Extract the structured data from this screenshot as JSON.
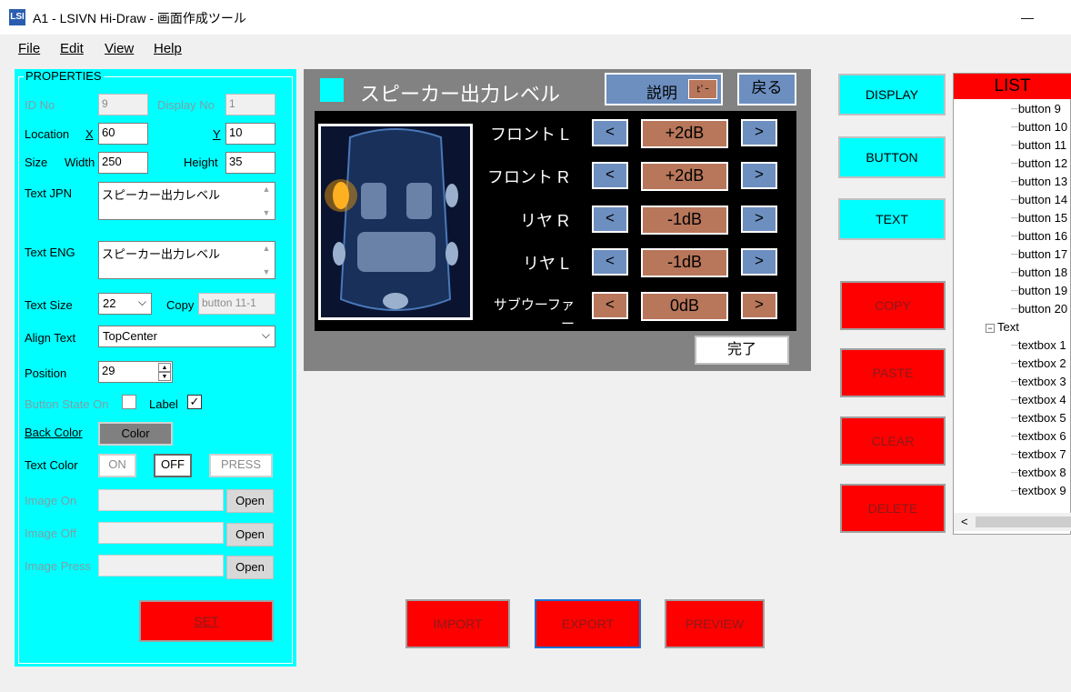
{
  "window": {
    "app_icon": "LSI",
    "title": "A1 - LSIVN Hi-Draw - 画面作成ツール",
    "minimize": "—"
  },
  "menu": [
    "File",
    "Edit",
    "View",
    "Help"
  ],
  "properties": {
    "title": "PROPERTIES",
    "id_no_label": "ID No",
    "id_no": "9",
    "display_no_label": "Display No",
    "display_no": "1",
    "location_label": "Location",
    "x_label": "X",
    "x": "60",
    "y_label": "Y",
    "y": "10",
    "size_label": "Size",
    "width_label": "Width",
    "width": "250",
    "height_label": "Height",
    "height": "35",
    "text_jpn_label": "Text JPN",
    "text_jpn": "スピーカー出力レベル",
    "text_eng_label": "Text ENG",
    "text_eng": "スピーカー出力レベル",
    "text_size_label": "Text Size",
    "text_size": "22",
    "copy_label": "Copy",
    "copy_value": "button 11-1",
    "align_label": "Align Text",
    "align": "TopCenter",
    "position_label": "Position",
    "position": "29",
    "button_state_label": "Button State On",
    "label_label": "Label",
    "label_checked": "✓",
    "back_color_label": "Back Color",
    "color_button": "Color",
    "text_color_label": "Text Color",
    "on": "ON",
    "off": "OFF",
    "press": "PRESS",
    "image_on_label": "Image On",
    "image_off_label": "Image Off",
    "image_press_label": "Image Press",
    "open": "Open",
    "set": "SET"
  },
  "preview": {
    "title": "スピーカー出力レベル",
    "explain": "説明",
    "explain_icon": "ﾋﾟｰ",
    "back": "戻る",
    "rows": [
      {
        "label": "フロント L",
        "value": "+2dB"
      },
      {
        "label": "フロント R",
        "value": "+2dB"
      },
      {
        "label": "リヤ R",
        "value": "-1dB"
      },
      {
        "label": "リヤ L",
        "value": "-1dB"
      },
      {
        "label": "サブウーファー",
        "value": "0dB"
      }
    ],
    "left_arrow": "<",
    "right_arrow": ">",
    "done": "完了"
  },
  "actions": {
    "import": "IMPORT",
    "export": "EXPORT",
    "preview": "PREVIEW"
  },
  "side_buttons": {
    "display": "DISPLAY",
    "button": "BUTTON",
    "text": "TEXT",
    "copy": "COPY",
    "paste": "PASTE",
    "clear": "CLEAR",
    "delete": "DELETE"
  },
  "list": {
    "header": "LIST",
    "buttons": [
      "button 9",
      "button 10",
      "button 11",
      "button 12",
      "button 13",
      "button 14",
      "button 15",
      "button 16",
      "button 17",
      "button 18",
      "button 19",
      "button 20"
    ],
    "text_node": "Text",
    "textboxes": [
      "textbox 1",
      "textbox 2",
      "textbox 3",
      "textbox 4",
      "textbox 5",
      "textbox 6",
      "textbox 7",
      "textbox 8",
      "textbox 9"
    ],
    "scroll_left": "<"
  },
  "colors": {
    "panel": "#00ffff",
    "danger": "#ff0000",
    "value_box": "#b8765a",
    "nav_button": "#6d8fc0"
  }
}
